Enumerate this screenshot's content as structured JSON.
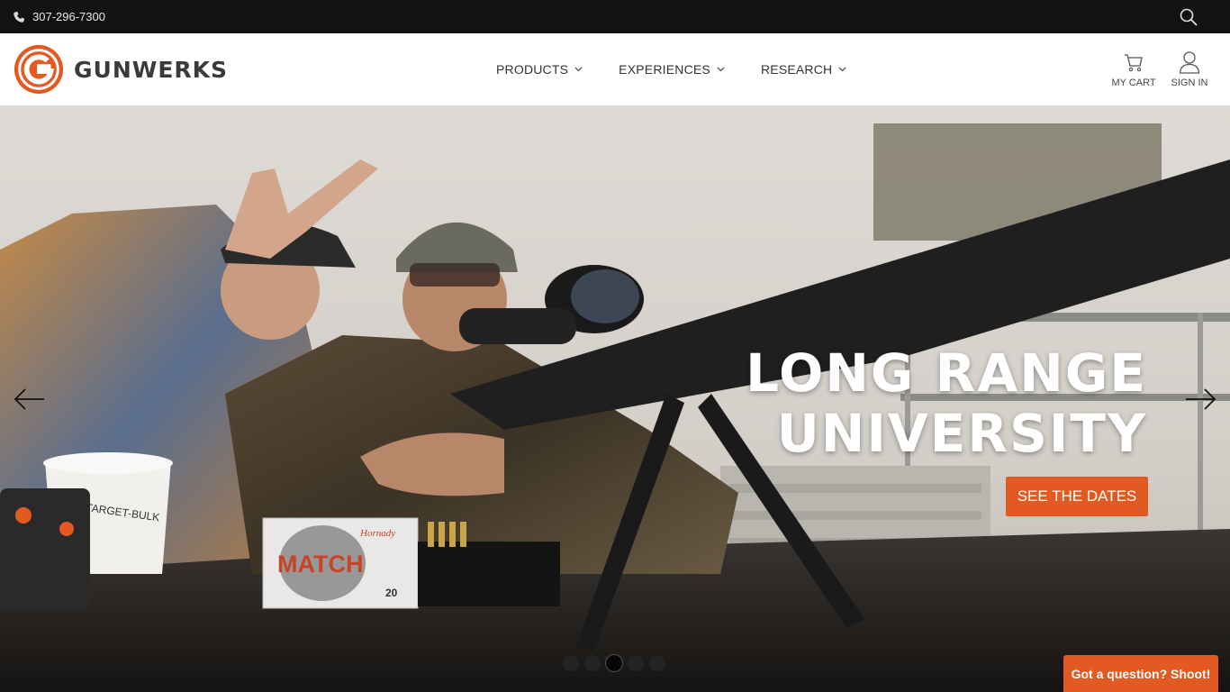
{
  "topbar": {
    "phone": "307-296-7300",
    "phone_icon": "phone-icon",
    "search_icon": "search-icon"
  },
  "header": {
    "brand": "GUNWERKS",
    "logo_icon": "gunwerks-g-logo",
    "nav": [
      {
        "label": "PRODUCTS"
      },
      {
        "label": "EXPERIENCES"
      },
      {
        "label": "RESEARCH"
      }
    ],
    "cart_label": "MY CART",
    "cart_icon": "cart-icon",
    "signin_label": "SIGN IN",
    "signin_icon": "user-icon"
  },
  "hero": {
    "title_line1": "LONG RANGE",
    "title_line2": "UNIVERSITY",
    "cta": "SEE THE DATES",
    "ammo_brand": "Hornady",
    "ammo_name": "MATCH",
    "ammo_count": "20",
    "bucket_label": "TARGET-BULK",
    "slide_count": 5,
    "active_slide": 3
  },
  "chat": {
    "label": "Got a question? Shoot!"
  },
  "colors": {
    "accent": "#e25a22",
    "topbar": "#121212"
  }
}
